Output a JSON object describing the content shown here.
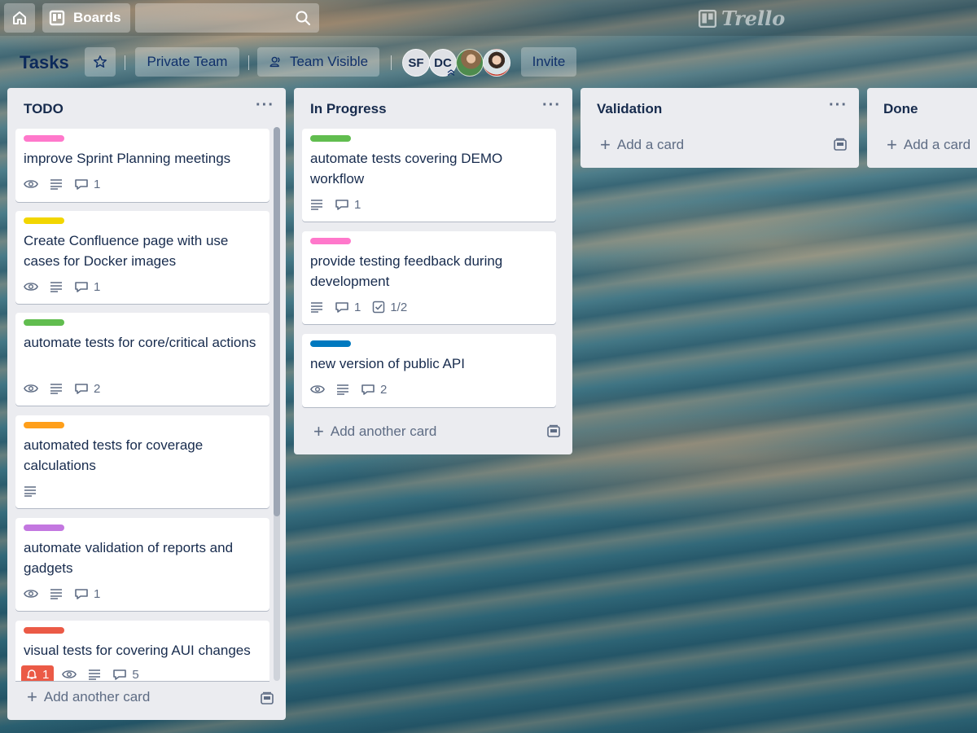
{
  "nav": {
    "boards_label": "Boards",
    "logo_text": "Trello"
  },
  "board": {
    "title": "Tasks",
    "team_label": "Private Team",
    "visibility_label": "Team Visible",
    "invite_label": "Invite",
    "members": [
      "SF",
      "DC"
    ]
  },
  "lists": [
    {
      "title": "TODO",
      "add_label": "Add another card",
      "cards": [
        {
          "label_color": "#ff78cb",
          "title": "improve Sprint Planning meetings",
          "comments": "1"
        },
        {
          "label_color": "#f2d600",
          "title": "Create Confluence page with use cases for Docker images",
          "comments": "1"
        },
        {
          "label_color": "#61bd4f",
          "title": "automate tests for core/critical actions",
          "comments": "2"
        },
        {
          "label_color": "#ff9f1a",
          "title": "automated tests for coverage calculations"
        },
        {
          "label_color": "#c377e0",
          "title": "automate validation of reports and gadgets",
          "comments": "1"
        },
        {
          "label_color": "#eb5a46",
          "title": "visual tests for covering AUI changes",
          "alarm": "1",
          "comments": "5"
        }
      ]
    },
    {
      "title": "In Progress",
      "add_label": "Add another card",
      "cards": [
        {
          "label_color": "#61bd4f",
          "title": "automate tests covering DEMO workflow",
          "comments": "1"
        },
        {
          "label_color": "#ff78cb",
          "title": "provide testing feedback during development",
          "comments": "1",
          "checklist": "1/2"
        },
        {
          "label_color": "#0079bf",
          "title": "new version of public API",
          "comments": "2"
        }
      ]
    },
    {
      "title": "Validation",
      "add_label": "Add a card"
    },
    {
      "title": "Done",
      "add_label": "Add a card"
    }
  ],
  "colors": {
    "alarm": "#eb5a46",
    "list_bg": "#ebecf0"
  }
}
